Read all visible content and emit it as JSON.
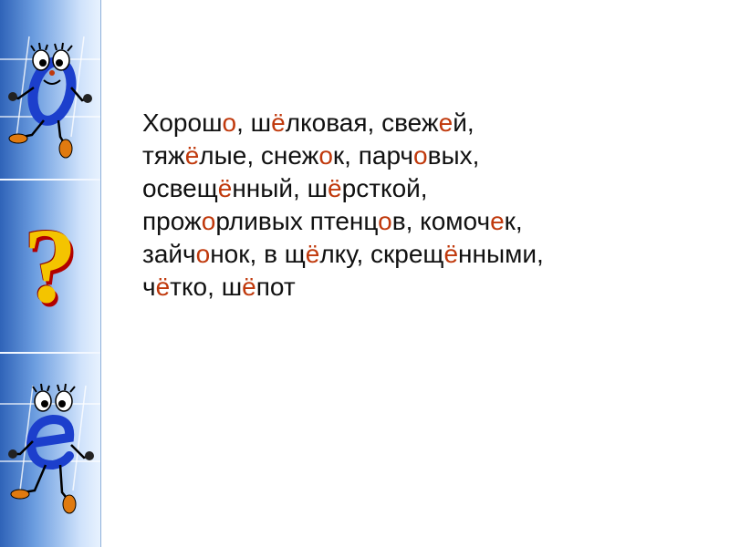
{
  "colors": {
    "text": "#111111",
    "highlight": "#c0390c",
    "sidebar_dark": "#2f63b8",
    "sidebar_light": "#e8f2fe",
    "question_fill": "#f4c400",
    "question_shadow": "#b20000",
    "letter_blue": "#1c3fcc"
  },
  "sidebar": {
    "top_letter": "о",
    "question_mark": "?",
    "bottom_letter": "е"
  },
  "lines": [
    [
      {
        "t": "Хорош",
        "hl": false
      },
      {
        "t": "о",
        "hl": true
      },
      {
        "t": ", ш",
        "hl": false
      },
      {
        "t": "ё",
        "hl": true
      },
      {
        "t": "лковая, свеж",
        "hl": false
      },
      {
        "t": "е",
        "hl": true
      },
      {
        "t": "й,",
        "hl": false
      }
    ],
    [
      {
        "t": "тяж",
        "hl": false
      },
      {
        "t": "ё",
        "hl": true
      },
      {
        "t": "лые, снеж",
        "hl": false
      },
      {
        "t": "о",
        "hl": true
      },
      {
        "t": "к, парч",
        "hl": false
      },
      {
        "t": "о",
        "hl": true
      },
      {
        "t": "вых,",
        "hl": false
      }
    ],
    [
      {
        "t": "освещ",
        "hl": false
      },
      {
        "t": "ё",
        "hl": true
      },
      {
        "t": "нный, ш",
        "hl": false
      },
      {
        "t": "ё",
        "hl": true
      },
      {
        "t": "рсткой,",
        "hl": false
      }
    ],
    [
      {
        "t": "прож",
        "hl": false
      },
      {
        "t": "о",
        "hl": true
      },
      {
        "t": "рливых птенц",
        "hl": false
      },
      {
        "t": "о",
        "hl": true
      },
      {
        "t": "в, комоч",
        "hl": false
      },
      {
        "t": "е",
        "hl": true
      },
      {
        "t": "к,",
        "hl": false
      }
    ],
    [
      {
        "t": "зайч",
        "hl": false
      },
      {
        "t": "о",
        "hl": true
      },
      {
        "t": "нок, в щ",
        "hl": false
      },
      {
        "t": "ё",
        "hl": true
      },
      {
        "t": "лку, скрещ",
        "hl": false
      },
      {
        "t": "ё",
        "hl": true
      },
      {
        "t": "нными,",
        "hl": false
      }
    ],
    [
      {
        "t": "ч",
        "hl": false
      },
      {
        "t": "ё",
        "hl": true
      },
      {
        "t": "тко, ш",
        "hl": false
      },
      {
        "t": "ё",
        "hl": true
      },
      {
        "t": "пот",
        "hl": false
      }
    ]
  ]
}
